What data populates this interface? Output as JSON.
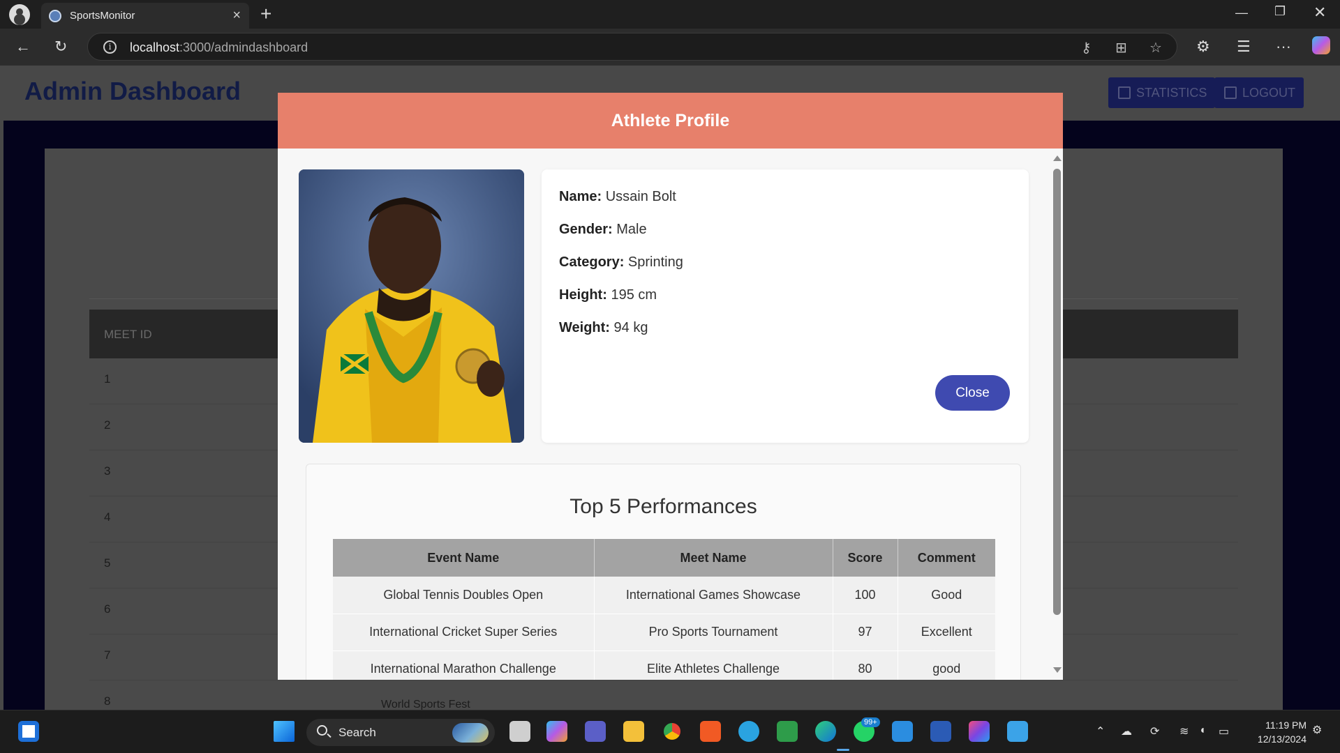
{
  "browser": {
    "tab_title": "SportsMonitor",
    "url_host": "localhost",
    "url_path": ":3000/admindashboard"
  },
  "page": {
    "title": "Admin Dashboard",
    "statistics_label": "STATISTICS",
    "logout_label": "LOGOUT",
    "table_header": "MEET ID",
    "row_ids": [
      "1",
      "2",
      "3",
      "4",
      "5",
      "6",
      "7",
      "8"
    ],
    "partial_event": "World Sports Fest"
  },
  "modal": {
    "title": "Athlete Profile",
    "fields": [
      {
        "label": "Name:",
        "value": "Ussain Bolt"
      },
      {
        "label": "Gender:",
        "value": "Male"
      },
      {
        "label": "Category:",
        "value": "Sprinting"
      },
      {
        "label": "Height:",
        "value": "195 cm"
      },
      {
        "label": "Weight:",
        "value": "94 kg"
      }
    ],
    "close_label": "Close",
    "performances": {
      "title": "Top 5 Performances",
      "columns": [
        "Event Name",
        "Meet Name",
        "Score",
        "Comment"
      ],
      "rows": [
        [
          "Global Tennis Doubles Open",
          "International Games Showcase",
          "100",
          "Good"
        ],
        [
          "International Cricket Super Series",
          "Pro Sports Tournament",
          "97",
          "Excellent"
        ],
        [
          "International Marathon Challenge",
          "Elite Athletes Challenge",
          "80",
          "good"
        ]
      ]
    }
  },
  "taskbar": {
    "search_label": "Search",
    "whatsapp_badge": "99+",
    "time": "11:19 PM",
    "date": "12/13/2024"
  },
  "colors": {
    "modal_header": "#e7806b",
    "close_button": "#3f4ab0",
    "table_header": "#a3a3a3",
    "admin_title": "#111b46"
  }
}
